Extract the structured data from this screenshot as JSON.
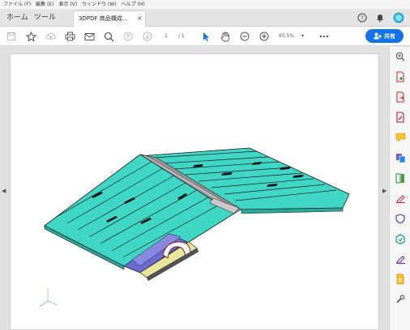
{
  "menu": [
    "ファイル (F)",
    "編集 (E)",
    "表示 (V)",
    "ウィンドウ (W)",
    "ヘルプ (H)"
  ],
  "tabs": {
    "home": "ホーム",
    "tools": "ツール",
    "document": "3DPDF 商品構成...",
    "close": "×"
  },
  "toolbar": {
    "page_current": "1",
    "page_total": "/ 1",
    "zoom": "65.5%",
    "zoom_caret": "▾",
    "share_label": "共有"
  },
  "nav": {
    "left": "◀",
    "right": "▶"
  },
  "icons": {
    "toolbar": [
      "save-icon",
      "star-icon",
      "cloud-upload-icon",
      "print-icon",
      "email-icon",
      "search-icon",
      "page-up-icon",
      "page-down-icon",
      "select-cursor-icon",
      "hand-icon",
      "zoom-out-icon",
      "zoom-in-icon",
      "more-icon",
      "share-icon"
    ],
    "right_panel": [
      "zoom-tool-icon",
      "create-pdf-icon",
      "export-pdf-icon",
      "edit-pdf-icon",
      "comment-icon",
      "combine-icon",
      "organize-pages-icon",
      "fill-sign-icon",
      "protect-icon",
      "optimize-icon",
      "sign-icon",
      "scan-icon",
      "tools-icon"
    ]
  },
  "colors": {
    "accent": "#1473e6",
    "roof": "#3fd6c6",
    "roof_dark": "#1d1d1d",
    "wall": "#6a6ad0",
    "insulation": "#e8e69a"
  }
}
